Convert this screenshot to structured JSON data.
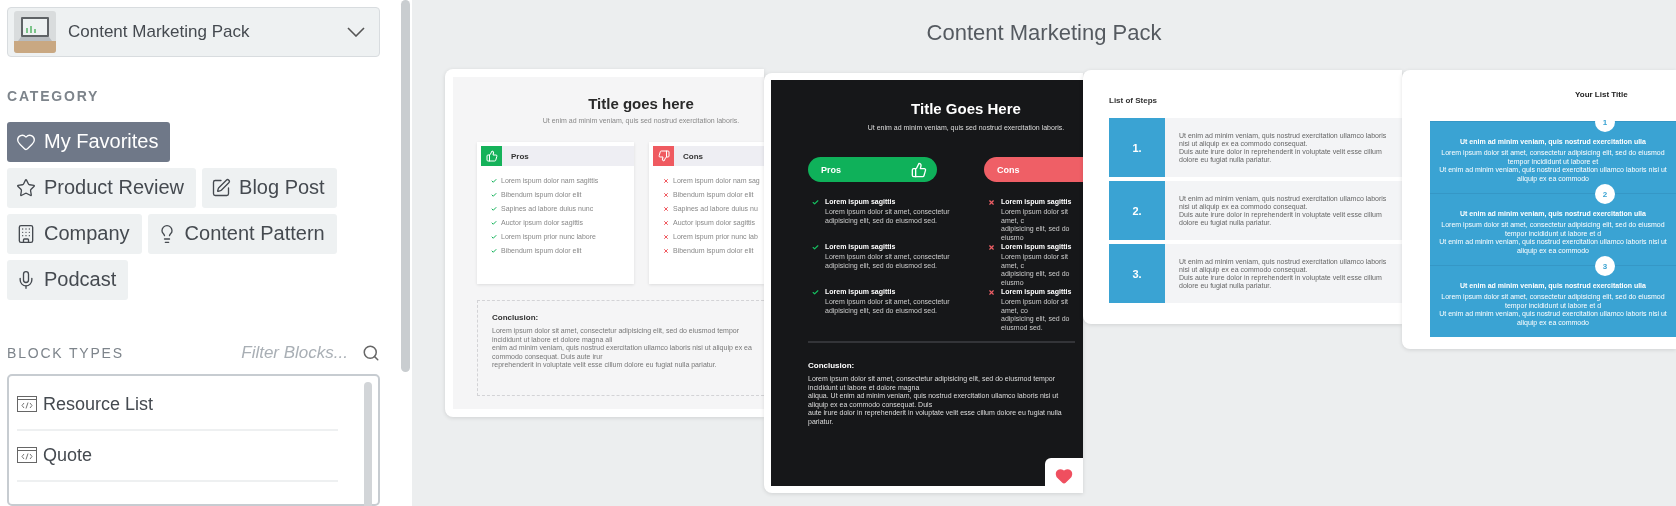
{
  "pack_selector": {
    "title": "Content Marketing Pack"
  },
  "category": {
    "heading": "CATEGORY",
    "items": [
      {
        "label": "My Favorites",
        "selected": true
      },
      {
        "label": "Product Review",
        "selected": false
      },
      {
        "label": "Blog Post",
        "selected": false
      },
      {
        "label": "Company",
        "selected": false
      },
      {
        "label": "Content Pattern",
        "selected": false
      },
      {
        "label": "Podcast",
        "selected": false
      }
    ]
  },
  "block_types": {
    "heading": "BLOCK TYPES",
    "filter": {
      "placeholder": "Filter Blocks..."
    },
    "items": [
      {
        "label": "Resource List"
      },
      {
        "label": "Quote"
      }
    ]
  },
  "gallery": {
    "title": "Content Marketing Pack",
    "previews": [
      {
        "kind": "pros-cons-light",
        "title": "Title goes here",
        "subtitle": "Ut enim ad minim veniam, quis sed nostrud exercitation laboris.",
        "pros": {
          "label": "Pros",
          "items": [
            "Lorem ispum dolor nam sagittis",
            "Bibendum  ispum dolor elit",
            "Sapines ad labore duius nunc",
            "Auctor ipsum dolor sagittis",
            "Lorem ispum prior nunc labore",
            "Bibendum  ispum dolor elit"
          ]
        },
        "cons": {
          "label": "Cons",
          "items": [
            "Lorem ispum dolor nam sag",
            "Bibendum  ispum dolor elit",
            "Sapines ad labore duius nu",
            "Auctor ipsum dolor sagittis",
            "Lorem ispum prior nunc lab",
            "Bibendum  ispum dolor elit"
          ]
        },
        "conclusion": {
          "heading": "Conclusion:",
          "lines": [
            "Lorem ipsum dolor sit amet, consectetur adipisicing elit, sed do eiusmod tempor incididunt ut labore et dolore magna ali",
            "enim ad minim veniam, quis nostrud exercitation ullamco laboris nisi ut aliquip ex ea commodo consequat. Duis aute irur",
            "reprehenderit in voluptate velit esse cillum dolore eu fugiat nulla pariatur."
          ]
        }
      },
      {
        "kind": "pros-cons-dark",
        "favorite": true,
        "title": "Title Goes Here",
        "subtitle": "Ut enim ad minim veniam, quis sed nostrud exercitation laboris.",
        "pros": {
          "label": "Pros",
          "items": [
            {
              "heading": "Lorem ispum sagittis",
              "lines": [
                "Lorem ipsum dolor sit amet, consectetur",
                "adipisicing elit, sed do eiusmod sed."
              ]
            },
            {
              "heading": "Lorem ispum sagittis",
              "lines": [
                "Lorem ipsum dolor sit amet, consectetur",
                "adipisicing elit, sed do eiusmod sed."
              ]
            },
            {
              "heading": "Lorem ispum sagittis",
              "lines": [
                "Lorem ipsum dolor sit amet, consectetur",
                "adipisicing elit, sed do eiusmod sed."
              ]
            }
          ]
        },
        "cons": {
          "label": "Cons",
          "items": [
            {
              "heading": "Lorem ispum sagittis",
              "lines": [
                "Lorem ipsum dolor sit amet, c",
                "adipisicing elit, sed do eiusmo"
              ]
            },
            {
              "heading": "Lorem ispum sagittis",
              "lines": [
                "Lorem ipsum dolor sit amet, c",
                "adipisicing elit, sed do eiusmo"
              ]
            },
            {
              "heading": "Lorem ispum sagittis",
              "lines": [
                "Lorem ipsum dolor sit amet, co",
                "adipisicing elit, sed do eiusmod sed."
              ]
            }
          ]
        },
        "conclusion": {
          "heading": "Conclusion:",
          "lines": [
            "Lorem ipsum dolor sit amet, consectetur adipisicing elit, sed do eiusmod tempor incididunt ut labore et dolore magna",
            "aliqua. Ut enim ad minim veniam, quis nostrud exercitation ullamco laboris nisi ut aliquip ex ea commodo consequat. Duis",
            "aute irure dolor in reprehenderit in voluptate velit esse cillum dolore eu fugiat nulla pariatur."
          ]
        }
      },
      {
        "kind": "steps",
        "title": "List of Steps",
        "steps": [
          {
            "number": "1.",
            "lines": [
              "Ut enim ad minim veniam, quis nostrud exercitation ullamco laboris nisi ut aliquip ex ea commodo consequat.",
              "Duis aute irure dolor in reprehenderit in voluptate velit esse cillum dolore eu fugiat nulla pariatur."
            ]
          },
          {
            "number": "2.",
            "lines": [
              "Ut enim ad minim veniam, quis nostrud exercitation ullamco laboris nisi ut aliquip ex ea commodo consequat.",
              "Duis aute irure dolor in reprehenderit in voluptate velit esse cillum dolore eu fugiat nulla pariatur."
            ]
          },
          {
            "number": "3.",
            "lines": [
              "Ut enim ad minim veniam, quis nostrud exercitation ullamco laboris nisi ut aliquip ex ea commodo consequat.",
              "Duis aute irure dolor in reprehenderit in voluptate velit esse cillum dolore eu fugiat nulla pariatur."
            ]
          }
        ]
      },
      {
        "kind": "numbered",
        "title": "Your List Title",
        "items": [
          {
            "number": "1",
            "heading": "Ut enim ad minim veniam, quis nostrud exercitation ulla",
            "lines": [
              "Lorem ipsum dolor sit amet, consectetur adipisicing elit, sed do eiusmod tempor incididunt ut labore et",
              "Ut enim ad minim veniam, quis nostrud exercitation ullamco laboris nisi ut aliquip ex ea commodo"
            ]
          },
          {
            "number": "2",
            "heading": "Ut enim ad minim veniam, quis nostrud exercitation ulla",
            "lines": [
              "Lorem ipsum dolor sit amet, consectetur adipisicing elit, sed do eiusmod tempor incididunt ut labore et d",
              "Ut enim ad minim veniam, quis nostrud exercitation ullamco laboris nisi ut aliquip ex ea commodo"
            ]
          },
          {
            "number": "3",
            "heading": "Ut enim ad minim veniam, quis nostrud exercitation ulla",
            "lines": [
              "Lorem ipsum dolor sit amet, consectetur adipisicing elit, sed do eiusmod tempor incididunt ut labore et d",
              "Ut enim ad minim veniam, quis nostrud exercitation ullamco laboris nisi ut aliquip ex ea commodo"
            ]
          }
        ]
      }
    ]
  }
}
